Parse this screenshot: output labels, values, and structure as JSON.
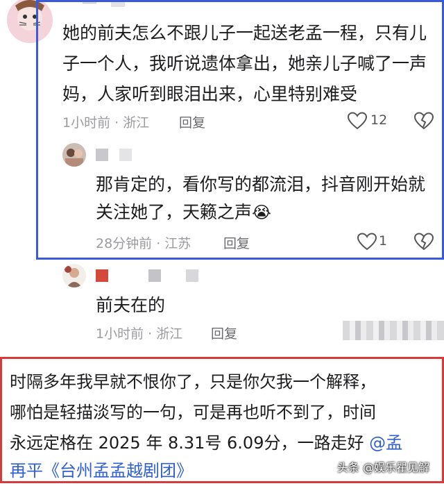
{
  "top_partial": {
    "name_glyph": "一"
  },
  "comment1": {
    "lines": [
      "她的前夫怎么不跟儿子一起送老孟一程，只有儿",
      "子一个人，我听说遗体拿出，她亲儿子喊了一声",
      "妈，人家听到眼泪出来，心里特别难受"
    ],
    "meta": "1小时前 · 浙江",
    "reply": "回复",
    "likes": "12"
  },
  "reply1": {
    "lines": [
      "那肯定的，看你写的都流泪，抖音刚开始就",
      "关注她了，天籁之声"
    ],
    "emoji": "😭",
    "meta": "28分钟前 · 江苏",
    "reply": "回复",
    "likes": "1"
  },
  "reply2": {
    "text": "前夫在的",
    "meta": "1小时前 · 浙江",
    "reply": "回复"
  },
  "post": {
    "lines": [
      "时隔多年我早就不恨你了，只是你欠我一个解释，",
      "哪怕是轻描淡写的一句，可是再也听不到了，时间",
      "永远定格在 2025 年 8.31号 6.09分，一路走好"
    ],
    "mention": "@孟",
    "line4_link": "再平《台州孟孟越剧团》"
  },
  "watermark": "头条 @娱乐瞿见解",
  "colors": {
    "blue_frame": "#3a5bd9",
    "red_frame": "#d63a3a",
    "link": "#2f5fd0"
  },
  "icons": [
    "heart-icon",
    "dislike-heart-icon",
    "crying-face-emoji"
  ]
}
